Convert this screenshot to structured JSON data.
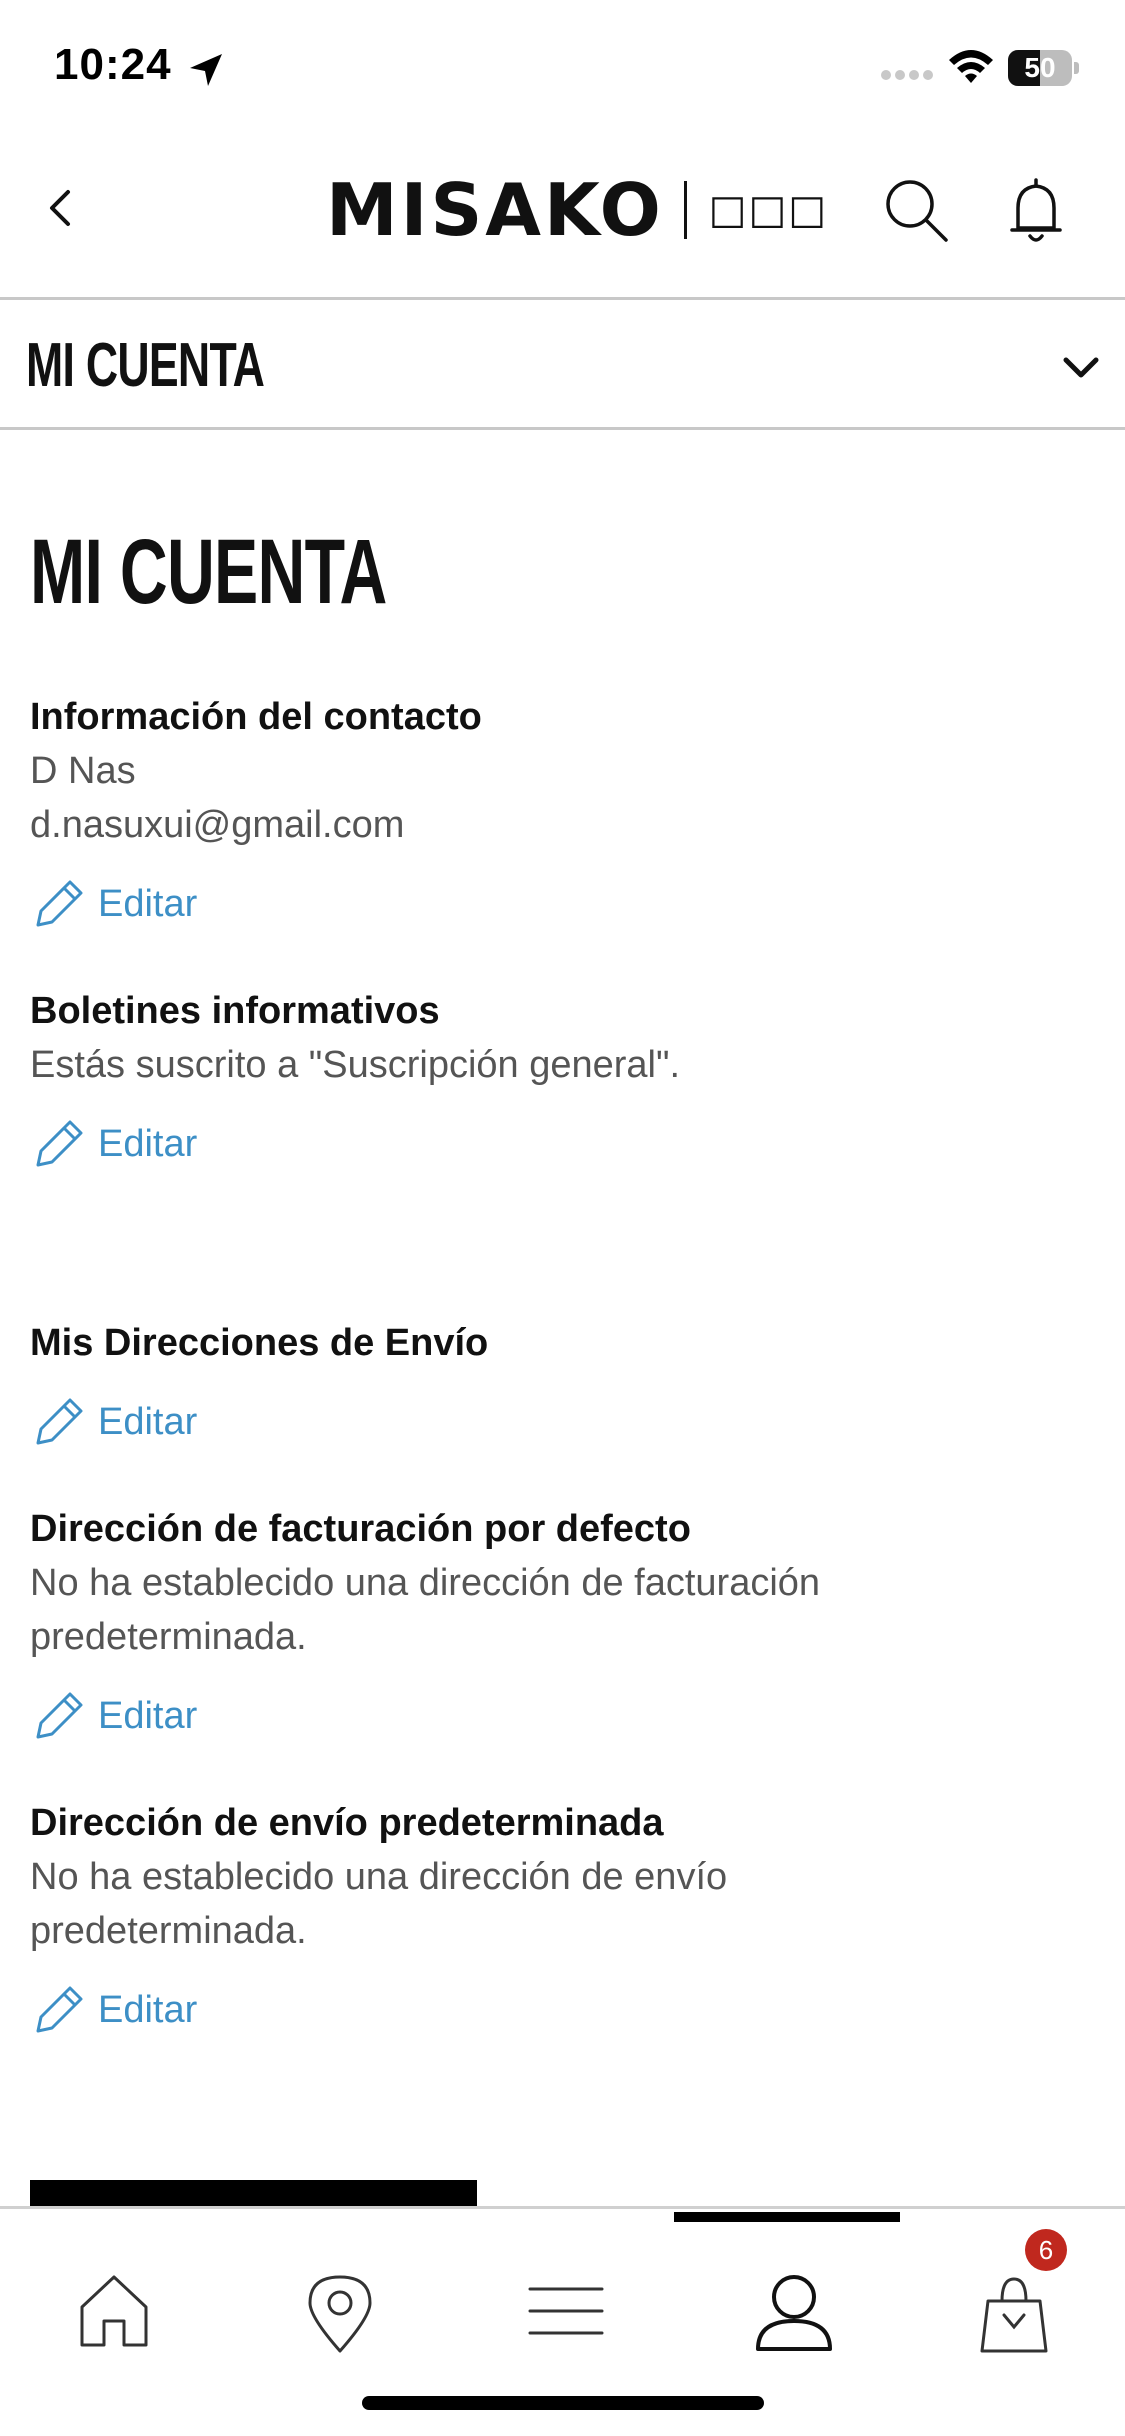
{
  "status_bar": {
    "time": "10:24",
    "battery_level": "50",
    "battery_fraction": 0.5
  },
  "header": {
    "logo": "MISAKO",
    "logo_sub": "□□□"
  },
  "account_bar": {
    "label": "MI CUENTA"
  },
  "page": {
    "title": "MI CUENTA"
  },
  "sections": {
    "contact": {
      "title": "Información del contacto",
      "name": "D Nas",
      "email": "d.nasuxui@gmail.com",
      "edit_label": "Editar"
    },
    "newsletters": {
      "title": "Boletines informativos",
      "text": "Estás suscrito a \"Suscripción general\".",
      "edit_label": "Editar"
    },
    "shipping_addresses": {
      "title": "Mis Direcciones de Envío",
      "edit_label": "Editar"
    },
    "billing": {
      "title": "Dirección de facturación por defecto",
      "text": "No ha establecido una dirección de facturación predeterminada.",
      "edit_label": "Editar"
    },
    "default_shipping": {
      "title": "Dirección de envío predeterminada",
      "text": "No ha establecido una dirección de envío predeterminada.",
      "edit_label": "Editar"
    }
  },
  "tabbar": {
    "active_tab": "account",
    "cart_count": "6",
    "icons": [
      "home-icon",
      "location-icon",
      "menu-icon",
      "account-icon",
      "shopping-bag-icon"
    ]
  },
  "colors": {
    "accent_link": "#3d8fc6",
    "badge": "#c0281e",
    "text": "#111111",
    "muted_text": "#555555"
  }
}
